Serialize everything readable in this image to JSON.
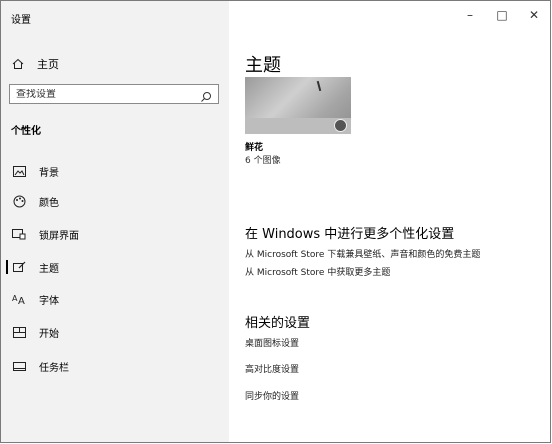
{
  "window": {
    "title": "设置"
  },
  "titlebar": {
    "minimize": "–",
    "maximize": "□",
    "close": "✕"
  },
  "sidebar": {
    "home_label": "主页",
    "search_placeholder": "查找设置",
    "section_title": "个性化",
    "items": [
      {
        "label": "背景",
        "icon": "picture-icon"
      },
      {
        "label": "颜色",
        "icon": "palette-icon"
      },
      {
        "label": "锁屏界面",
        "icon": "lock-screen-icon"
      },
      {
        "label": "主题",
        "icon": "theme-brush-icon",
        "active": true
      },
      {
        "label": "字体",
        "icon": "font-icon"
      },
      {
        "label": "开始",
        "icon": "start-icon"
      },
      {
        "label": "任务栏",
        "icon": "taskbar-icon"
      }
    ]
  },
  "main": {
    "title": "主题",
    "theme": {
      "name": "鲜花",
      "count": "6 个图像"
    },
    "more_section": {
      "heading": "在 Windows 中进行更多个性化设置",
      "links": [
        "从 Microsoft Store 下载兼具壁纸、声音和颜色的免费主题",
        "从 Microsoft Store 中获取更多主题"
      ]
    },
    "related_section": {
      "heading": "相关的设置",
      "links": [
        "桌面图标设置",
        "高对比度设置",
        "同步你的设置"
      ]
    }
  }
}
